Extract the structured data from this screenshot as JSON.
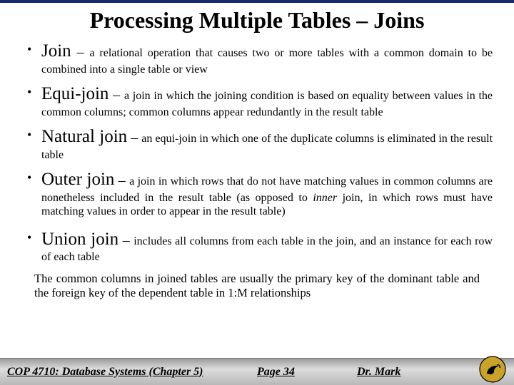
{
  "title": "Processing Multiple Tables – Joins",
  "items": [
    {
      "term": "Join",
      "dash": " – ",
      "def": "a relational operation that causes two or more tables with a common domain to be combined into a single table or view"
    },
    {
      "term": "Equi-join",
      "dash": " – ",
      "def": "a join in which the joining condition is based on equality between values in the common columns; common columns appear redundantly in the result table"
    },
    {
      "term": "Natural join",
      "dash": " – ",
      "def": "an equi-join in which one of the duplicate columns is eliminated in the result table"
    },
    {
      "term": "Outer join",
      "dash": " – ",
      "def_pre": "a join in which rows that do not have matching values in common columns are nonetheless included in the result table (as opposed to ",
      "def_em": "inner",
      "def_post": " join, in which rows must have matching values in order to appear in the result table)"
    },
    {
      "term": "Union join",
      "dash": " – ",
      "def": "includes all columns from each table in the join, and an instance for each row of each table"
    }
  ],
  "closing": "The common columns in joined tables are usually the primary key of the dominant table and the foreign key of the dependent table in 1:M relationships",
  "footer": {
    "course": "COP 4710: Database Systems (Chapter 5)",
    "page": "Page 34",
    "author": "Dr. Mark"
  },
  "logo_name": "ucf-pegasus-logo"
}
